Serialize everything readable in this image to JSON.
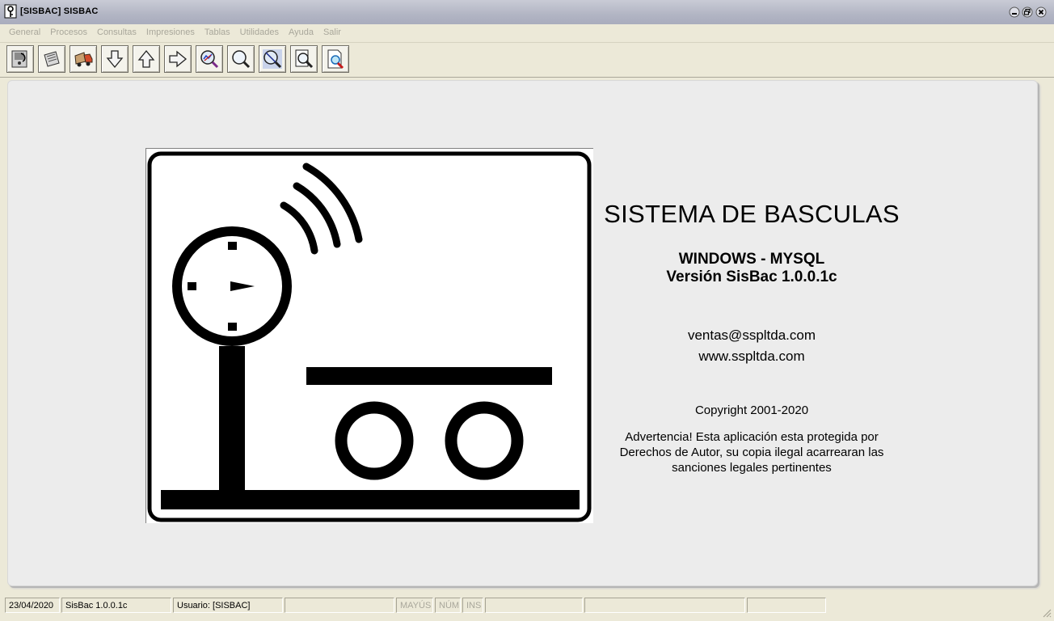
{
  "window": {
    "title": "[SISBAC] SISBAC",
    "controls": [
      "minimize-icon",
      "restore-icon",
      "close-icon"
    ]
  },
  "menu": {
    "items": [
      "General",
      "Procesos",
      "Consultas",
      "Impresiones",
      "Tablas",
      "Utilidades",
      "Ayuda",
      "Salir"
    ]
  },
  "toolbar": {
    "buttons": [
      "exit-icon",
      "scroll-icon",
      "truck-icon",
      "arrow-down-icon",
      "arrow-up-icon",
      "arrow-right-icon",
      "magnifier-chart-icon",
      "magnifier-icon",
      "magnifier-crossed-icon",
      "magnifier-document-icon",
      "print-preview-icon"
    ]
  },
  "content": {
    "title": "SISTEMA DE BASCULAS",
    "platform": "WINDOWS - MYSQL",
    "version": "Versión SisBac 1.0.0.1c",
    "email": "ventas@sspltda.com",
    "web": "www.sspltda.com",
    "copyright": "Copyright 2001-2020",
    "warning_line1": "Advertencia! Esta aplicación esta protegida por",
    "warning_line2": "Derechos de Autor, su copia ilegal acarrearan las",
    "warning_line3": "sanciones legales pertinentes"
  },
  "status": {
    "date": "23/04/2020",
    "app_version": "SisBac 1.0.0.1c",
    "user": "Usuario: [SISBAC]",
    "caps": "MAYÚS",
    "num": "NÚM",
    "ins": "INS"
  },
  "colors": {
    "titlebar": "#b2b5c4",
    "chrome": "#ece9d8",
    "panel": "#ececec",
    "disabled_text": "#a9a79b"
  }
}
